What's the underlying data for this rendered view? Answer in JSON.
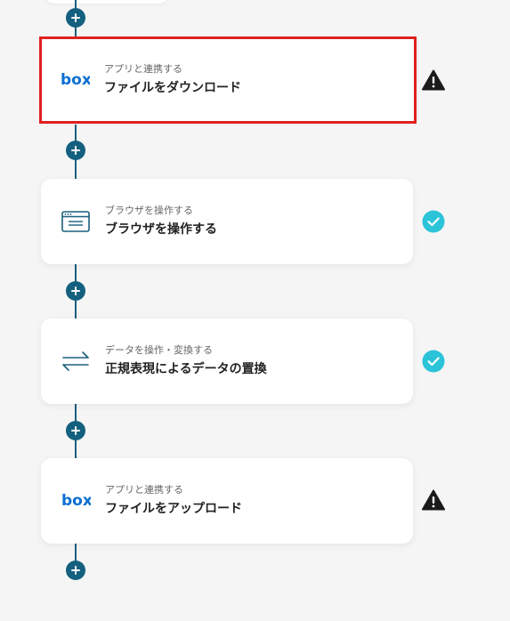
{
  "colors": {
    "connector": "#1b5f7e",
    "add_button": "#14607f",
    "selected_border": "#e02020",
    "success": "#2bc3d8",
    "warning": "#1a1a1a",
    "box_brand": "#0b6fd1"
  },
  "steps": [
    {
      "subtitle": "アプリと連携する",
      "title": "ファイルをダウンロード",
      "icon": "box-logo-icon",
      "icon_text": "box",
      "status": "warning",
      "selected": true
    },
    {
      "subtitle": "ブラウザを操作する",
      "title": "ブラウザを操作する",
      "icon": "browser-window-icon",
      "status": "success",
      "selected": false
    },
    {
      "subtitle": "データを操作・変換する",
      "title": "正規表現によるデータの置換",
      "icon": "swap-arrows-icon",
      "status": "success",
      "selected": false
    },
    {
      "subtitle": "アプリと連携する",
      "title": "ファイルをアップロード",
      "icon": "box-logo-icon",
      "icon_text": "box",
      "status": "warning",
      "selected": false
    }
  ]
}
